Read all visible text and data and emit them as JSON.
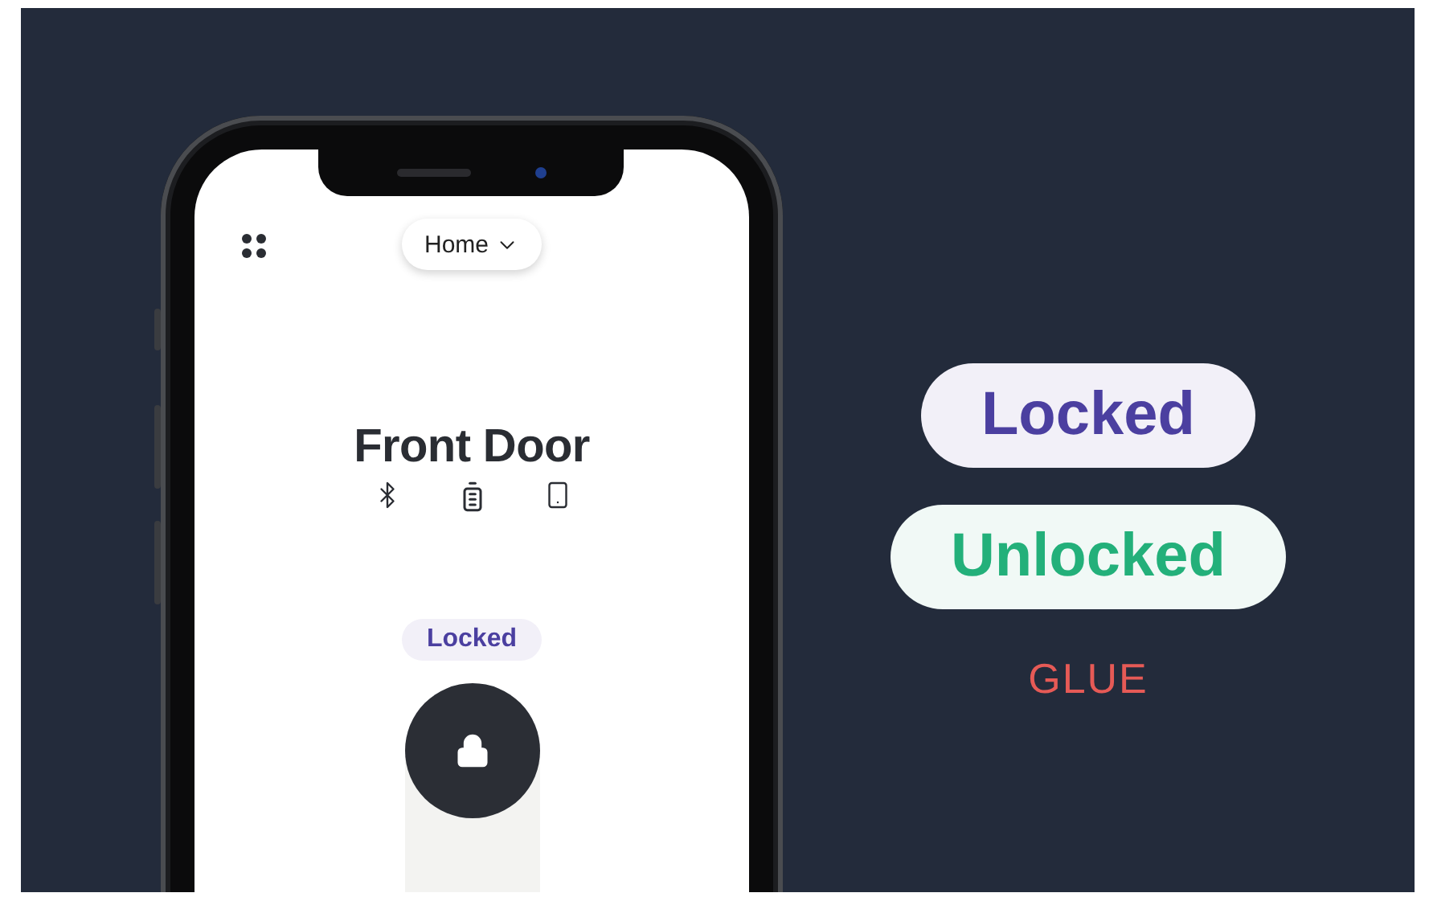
{
  "app": {
    "location": "Home",
    "device_name": "Front Door",
    "status": {
      "label": "Locked",
      "kind": "locked"
    }
  },
  "badges": [
    {
      "label": "Locked",
      "kind": "locked"
    },
    {
      "label": "Unlocked",
      "kind": "unlocked"
    }
  ],
  "brand": {
    "logo": "GLUE"
  }
}
